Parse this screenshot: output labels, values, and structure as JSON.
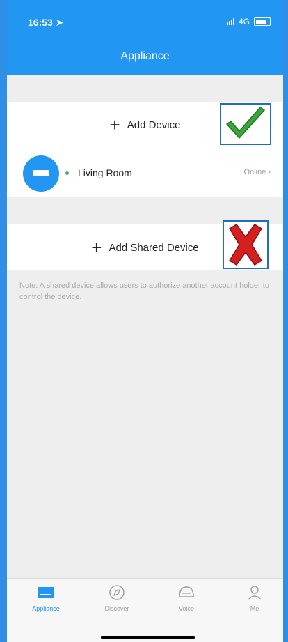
{
  "status_bar": {
    "time": "16:53",
    "network": "4G"
  },
  "header": {
    "title": "Appliance"
  },
  "add_device": {
    "label": "Add Device"
  },
  "device": {
    "name": "Living Room",
    "status": "Online"
  },
  "add_shared_device": {
    "label": "Add Shared Device"
  },
  "note": {
    "text": "Note: A shared device allows users to authorize another account holder to control the device."
  },
  "tabs": [
    {
      "label": "Appliance",
      "icon": "appliance-icon",
      "active": true
    },
    {
      "label": "Discover",
      "icon": "compass-icon",
      "active": false
    },
    {
      "label": "Voice",
      "icon": "speaker-icon",
      "active": false
    },
    {
      "label": "Me",
      "icon": "user-icon",
      "active": false
    }
  ],
  "colors": {
    "accent": "#2196f3",
    "online": "#4caf50",
    "check": "#3aa53a",
    "cross": "#d62020"
  }
}
